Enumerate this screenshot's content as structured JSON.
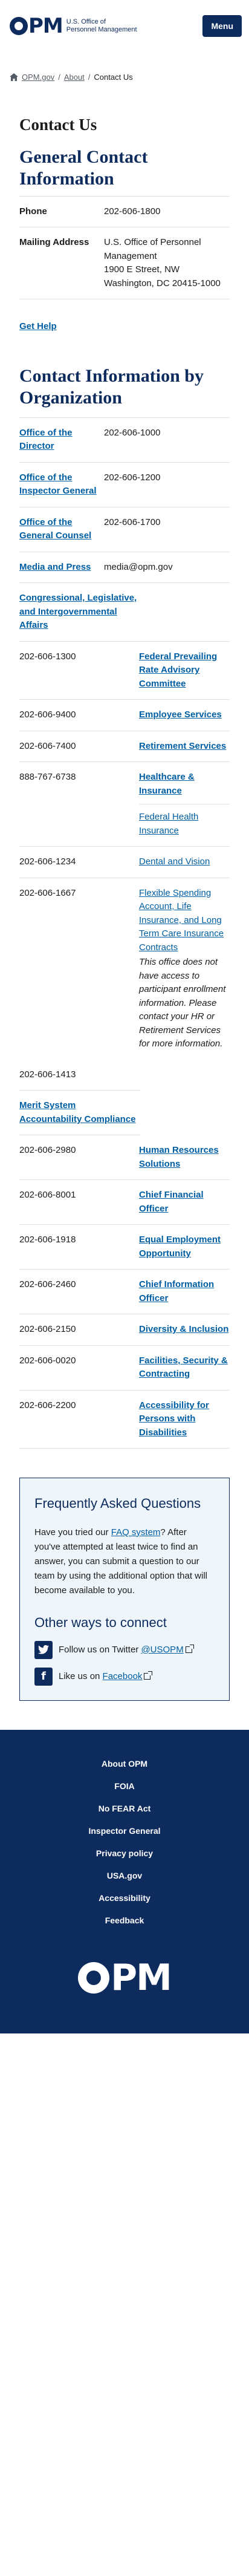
{
  "header": {
    "logo_letters": "PM",
    "logo_line1": "U.S. Office of",
    "logo_line2": "Personnel Management",
    "menu_label": "Menu"
  },
  "breadcrumb": [
    "OPM.gov",
    "About",
    "Contact Us"
  ],
  "page_title": "Contact Us",
  "general": {
    "title": "General Contact Information",
    "phone_label": "Phone",
    "phone": "202-606-1800",
    "mailing_label": "Mailing Address",
    "address_line1": "U.S. Office of Personnel Management",
    "address_line2": "1900 E Street, NW",
    "address_line3": "Washington, DC 20415-1000",
    "get_help": "Get Help"
  },
  "org": {
    "title": "Contact Information by Organization",
    "rows": [
      {
        "name": "Office of the Director",
        "value": "202-606-1000"
      },
      {
        "name": "Office of the Inspector General",
        "value": "202-606-1200"
      },
      {
        "name": "Office of the General Counsel",
        "value": "202-606-1700"
      },
      {
        "name": "Media and Press",
        "value": "media@opm.gov"
      }
    ],
    "congressional": "Congressional, Legislative, and Intergovernmental Affairs",
    "pairs": [
      {
        "phone": "202-606-1300",
        "name": "Federal Prevailing Rate Advisory Committee"
      },
      {
        "phone": "202-606-9400",
        "name": "Employee Services"
      },
      {
        "phone": "202-606-7400",
        "name": "Retirement Services"
      },
      {
        "phone": "888-767-6738",
        "name": "Healthcare & Insurance",
        "sub": "Federal Health Insurance"
      },
      {
        "phone": "202-606-1234",
        "name": "Dental and Vision"
      },
      {
        "phone": "202-606-1667",
        "name": "Flexible Spending Account, Life Insurance, and Long Term Care Insurance Contracts",
        "note": "This office does not have access to participant enrollment information. Please contact your HR or Retirement Services for more information."
      }
    ],
    "msac_phone": "202-606-1413",
    "msac_name": "Merit System Accountability Compliance",
    "pairs2": [
      {
        "phone": "202-606-2980",
        "name": "Human Resources Solutions"
      },
      {
        "phone": "202-606-8001",
        "name": "Chief Financial Officer"
      },
      {
        "phone": "202-606-1918",
        "name": "Equal Employment Opportunity"
      },
      {
        "phone": "202-606-2460",
        "name": "Chief Information Officer"
      },
      {
        "phone": "202-606-2150",
        "name": "Diversity & Inclusion"
      },
      {
        "phone": "202-606-0020",
        "name": "Facilities, Security & Contracting"
      },
      {
        "phone": "202-606-2200",
        "name": "Accessibility for Persons with Disabilities"
      }
    ]
  },
  "faq": {
    "title": "Frequently Asked Questions",
    "text_before": "Have you tried our ",
    "link": "FAQ system",
    "text_after": "? After you've attempted at least twice to find an answer, you can submit a question to our team by using the additional option that will become available to you.",
    "connect_title": "Other ways to connect",
    "twitter_text": "Follow us on Twitter ",
    "twitter_handle": "@USOPM",
    "facebook_text": "Like us on ",
    "facebook_link": "Facebook"
  },
  "footer": {
    "links": [
      "About OPM",
      "FOIA",
      "No FEAR Act",
      "Inspector General",
      "Privacy policy",
      "USA.gov",
      "Accessibility",
      "Feedback"
    ],
    "logo_letters": "PM"
  }
}
